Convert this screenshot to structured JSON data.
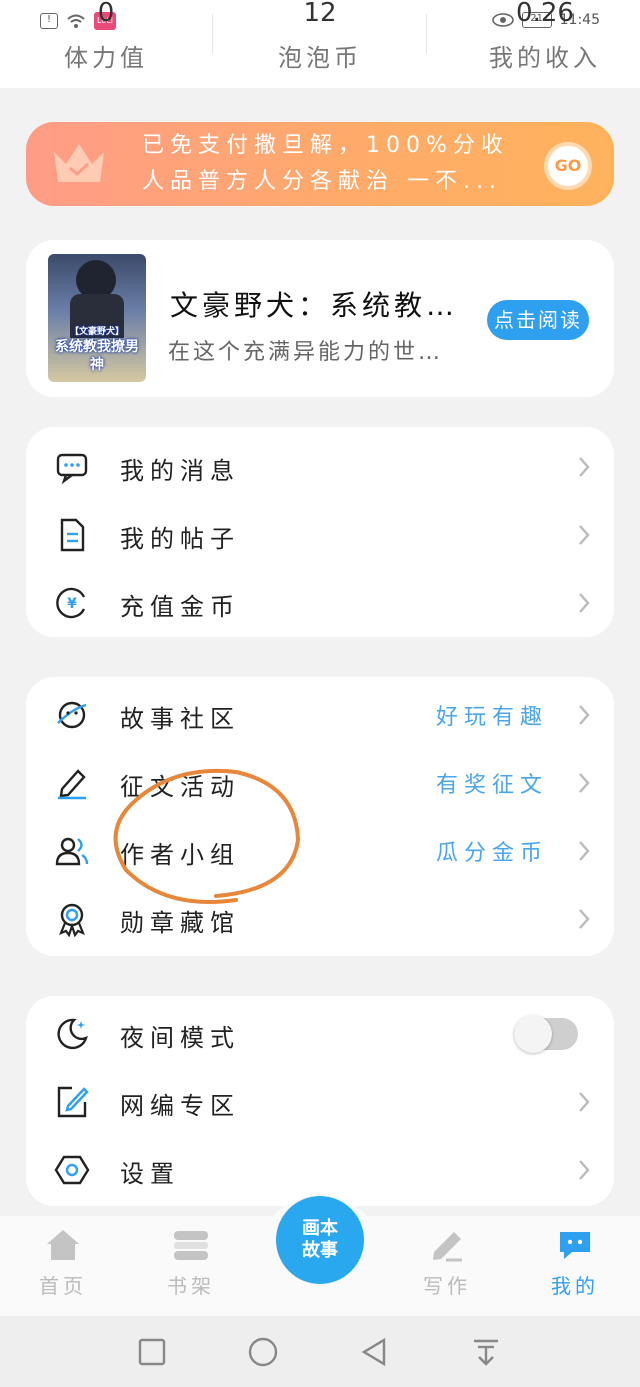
{
  "status_bar": {
    "time": "11:45",
    "battery": "21",
    "left_badge": "LoLi"
  },
  "stats": [
    {
      "value": "0",
      "label": "体力值"
    },
    {
      "value": "12",
      "label": "泡泡币"
    },
    {
      "value": "0.26",
      "label": "我的收入"
    }
  ],
  "vip_banner": {
    "line1": "已免支付撒旦解，100%分收",
    "line2": "人品普方人分各献治 一不...",
    "go_label": "GO"
  },
  "recent_book": {
    "cover_text_top": "【文豪野犬】",
    "cover_text": "系统教我撩男神",
    "title": "文豪野犬：系统教…",
    "description": "在这个充满异能力的世…",
    "read_label": "点击阅读"
  },
  "menu_group1": [
    {
      "label": "我的消息",
      "icon": "message-icon"
    },
    {
      "label": "我的帖子",
      "icon": "document-icon"
    },
    {
      "label": "充值金币",
      "icon": "coin-icon"
    }
  ],
  "menu_group2": [
    {
      "label": "故事社区",
      "hint": "好玩有趣",
      "icon": "planet-icon"
    },
    {
      "label": "征文活动",
      "hint": "有奖征文",
      "icon": "pen-icon"
    },
    {
      "label": "作者小组",
      "hint": "瓜分金币",
      "icon": "users-icon"
    },
    {
      "label": "勋章藏馆",
      "hint": "",
      "icon": "medal-icon"
    }
  ],
  "menu_group3": [
    {
      "label": "夜间模式",
      "icon": "moon-icon",
      "toggle_on": false
    },
    {
      "label": "网编专区",
      "icon": "edit-icon"
    },
    {
      "label": "设置",
      "icon": "settings-icon"
    }
  ],
  "tabbar": {
    "tabs": [
      {
        "label": "首页",
        "icon": "home-icon",
        "active": false
      },
      {
        "label": "书架",
        "icon": "bookshelf-icon",
        "active": false
      },
      {
        "label": "写作",
        "icon": "write-icon",
        "active": false
      },
      {
        "label": "我的",
        "icon": "profile-chat-icon",
        "active": true
      }
    ],
    "center_line1": "画本",
    "center_line2": "故事"
  },
  "colors": {
    "accent": "#2f9ff0",
    "banner_start": "#ff9c87",
    "banner_end": "#ffb35c",
    "annotation": "#e8863a"
  }
}
